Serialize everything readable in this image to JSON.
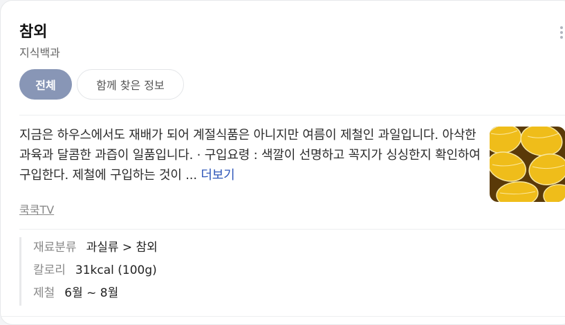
{
  "header": {
    "title": "참외",
    "subtitle": "지식백과"
  },
  "tabs": [
    {
      "label": "전체",
      "active": true
    },
    {
      "label": "함께 찾은 정보",
      "active": false
    }
  ],
  "summary": {
    "text": "지금은 하우스에서도 재배가 되어 계절식품은 아니지만 여름이 제철인 과일입니다. 아삭한 과육과 달콤한 과즙이 일품입니다. · 구입요령 : 색깔이 선명하고 꼭지가 싱싱한지 확인하여 구입한다. 제철에 구입하는 것이 ...",
    "more_label": "더보기",
    "source": "쿡쿡TV",
    "image_alt": "참외 사진"
  },
  "info": [
    {
      "label": "재료분류",
      "value": "과실류 > 참외"
    },
    {
      "label": "칼로리",
      "value": "31kcal (100g)"
    },
    {
      "label": "제철",
      "value": "6월 ~ 8월"
    }
  ],
  "colors": {
    "active_tab": "#8896b6",
    "link": "#2d55b8",
    "melon_yellow": "#f2c21d"
  },
  "icons": {
    "more": "more-vertical-icon"
  }
}
